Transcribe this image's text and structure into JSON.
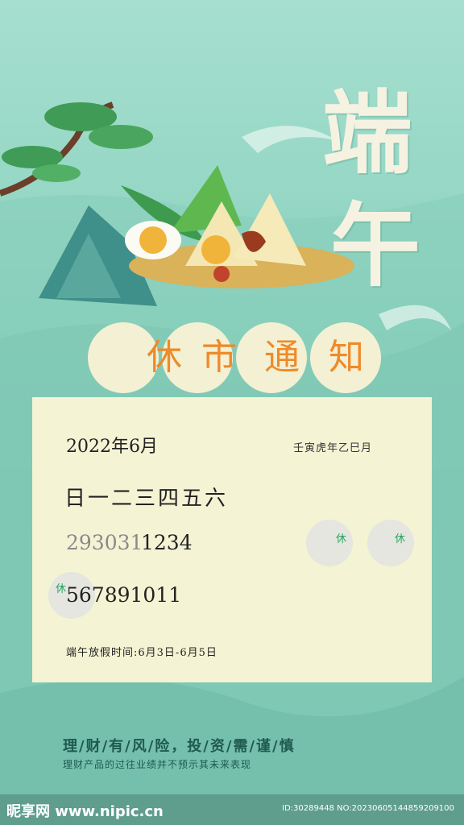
{
  "title": {
    "char1": "端",
    "char2": "午"
  },
  "notice": {
    "chars": [
      "休",
      "市",
      "通",
      "知"
    ]
  },
  "card": {
    "month_label": "2022年6月",
    "lunar_label": "壬寅虎年乙巳月",
    "weekdays": "日一二三四五六",
    "row1_prev": "293031",
    "row1_curr": "1234",
    "row2": "567891011",
    "rest_mark": "休",
    "holiday_text": "端午放假时间:6月3日-6月5日"
  },
  "footer": {
    "line1": "理/财/有/风/险，投/资/需/谨/慎",
    "line2": "理财产品的过往业绩并不预示其未来表现"
  },
  "watermark": {
    "brand": "昵享网 www.nipic.cn",
    "id": "ID:30289448 NO:20230605144859209100"
  },
  "colors": {
    "accent": "#ee8a2a",
    "rest_green": "#26a55e",
    "card_bg": "#f4f3d4"
  }
}
